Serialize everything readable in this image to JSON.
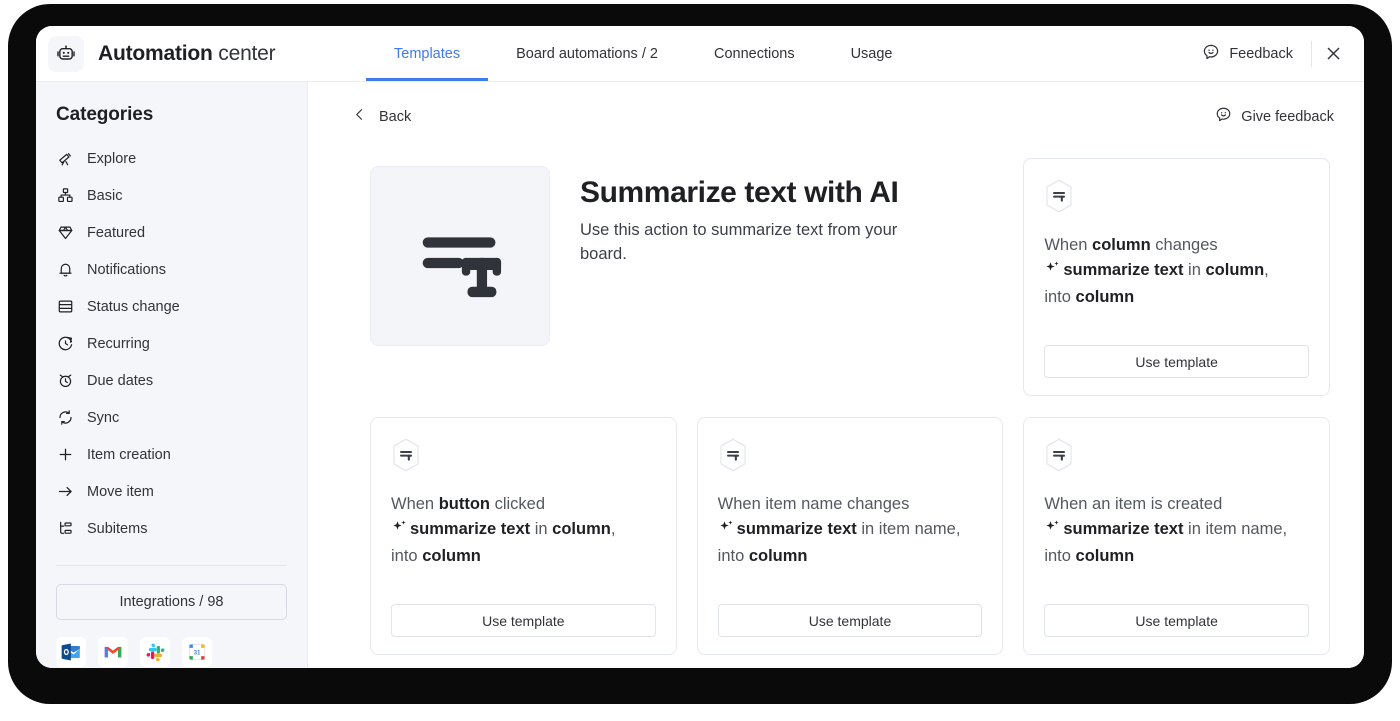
{
  "header": {
    "brand_icon": "robot-icon",
    "brand_strong": "Automation",
    "brand_light": " center",
    "tabs": [
      {
        "label": "Templates",
        "active": true
      },
      {
        "label": "Board automations / 2",
        "active": false
      },
      {
        "label": "Connections",
        "active": false
      },
      {
        "label": "Usage",
        "active": false
      }
    ],
    "feedback_label": "Feedback",
    "feedback_icon": "smiley-bubble-icon",
    "close_icon": "close-icon",
    "accent_color": "#3d7bf0"
  },
  "sidebar": {
    "title": "Categories",
    "items": [
      {
        "label": "Explore",
        "icon": "telescope-icon"
      },
      {
        "label": "Basic",
        "icon": "grid-blocks-icon"
      },
      {
        "label": "Featured",
        "icon": "diamond-icon"
      },
      {
        "label": "Notifications",
        "icon": "bell-icon"
      },
      {
        "label": "Status change",
        "icon": "table-rows-icon"
      },
      {
        "label": "Recurring",
        "icon": "clock-refresh-icon"
      },
      {
        "label": "Due dates",
        "icon": "alarm-clock-icon"
      },
      {
        "label": "Sync",
        "icon": "sync-arrows-icon"
      },
      {
        "label": "Item creation",
        "icon": "plus-icon"
      },
      {
        "label": "Move item",
        "icon": "arrow-right-icon"
      },
      {
        "label": "Subitems",
        "icon": "subitems-icon"
      }
    ],
    "integrations_label": "Integrations / 98",
    "app_icons": [
      {
        "name": "outlook-icon"
      },
      {
        "name": "gmail-icon"
      },
      {
        "name": "slack-icon"
      },
      {
        "name": "google-calendar-icon"
      }
    ]
  },
  "main": {
    "back_label": "Back",
    "back_icon": "chevron-left-icon",
    "give_feedback_label": "Give feedback",
    "give_feedback_icon": "smiley-bubble-icon",
    "hero": {
      "thumb_icon": "summarize-text-icon",
      "title": "Summarize text with AI",
      "description": "Use this action to summarize text from your board."
    },
    "cards": [
      {
        "badge_icon": "summarize-text-hex-icon",
        "line1_pre": "When ",
        "line1_bold": "column",
        "line1_post": " changes",
        "sparkle_icon": "sparkle-icon",
        "line2_bold": "summarize text",
        "line2_mid": " in ",
        "line2_bold2": "column",
        "line2_comma": ",",
        "line3_pre": "into ",
        "line3_bold": "column",
        "button_label": "Use template"
      },
      {
        "badge_icon": "summarize-text-hex-icon",
        "line1_pre": "When ",
        "line1_bold": "button",
        "line1_post": " clicked",
        "sparkle_icon": "sparkle-icon",
        "line2_bold": "summarize text",
        "line2_mid": " in ",
        "line2_bold2": "column",
        "line2_comma": ",",
        "line3_pre": "into ",
        "line3_bold": "column",
        "button_label": "Use template"
      },
      {
        "badge_icon": "summarize-text-hex-icon",
        "line1_pre": "When item name changes",
        "line1_bold": "",
        "line1_post": "",
        "sparkle_icon": "sparkle-icon",
        "line2_bold": "summarize text",
        "line2_mid": " in item name",
        "line2_bold2": "",
        "line2_comma": ",",
        "line3_pre": "into ",
        "line3_bold": "column",
        "button_label": "Use template"
      },
      {
        "badge_icon": "summarize-text-hex-icon",
        "line1_pre": "When an item is created",
        "line1_bold": "",
        "line1_post": "",
        "sparkle_icon": "sparkle-icon",
        "line2_bold": "summarize text",
        "line2_mid": " in item name",
        "line2_bold2": "",
        "line2_comma": ",",
        "line3_pre": "into ",
        "line3_bold": "column",
        "button_label": "Use template"
      }
    ]
  },
  "colors": {
    "sidebar_bg": "#f5f6fa",
    "text_dark": "#1f2023",
    "text_body": "#54585f",
    "border": "#e6e8ef",
    "accent": "#3d7bf0",
    "backdrop": "#0a0a0a"
  }
}
